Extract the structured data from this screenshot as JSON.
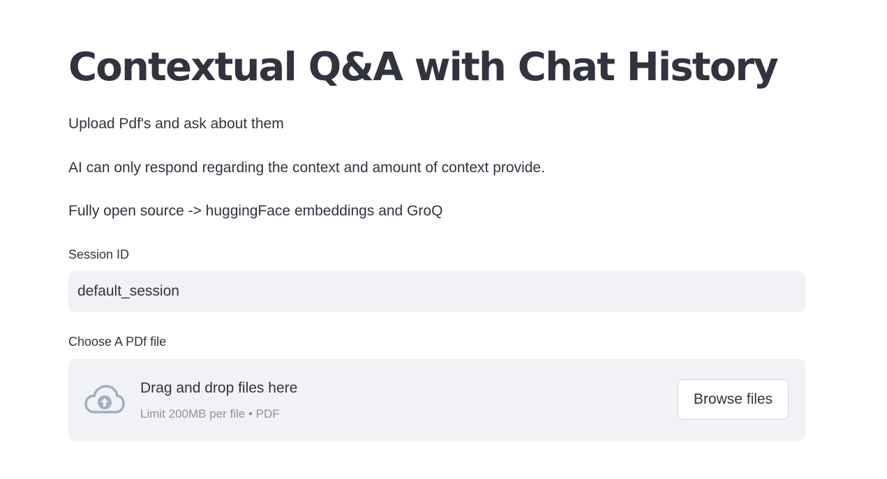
{
  "page": {
    "title": "Contextual Q&A with Chat History",
    "paragraphs": [
      "Upload Pdf's and ask about them",
      "AI can only respond regarding the context and amount of context provide.",
      "Fully open source -> huggingFace embeddings and GroQ"
    ]
  },
  "session": {
    "label": "Session ID",
    "value": "default_session"
  },
  "uploader": {
    "label": "Choose A PDf file",
    "drop_title": "Drag and drop files here",
    "drop_subtitle": "Limit 200MB per file • PDF",
    "browse_label": "Browse files",
    "icon": "cloud-upload-icon"
  },
  "colors": {
    "text": "#31333f",
    "input_bg": "#f0f2f6",
    "muted": "#8f929b",
    "icon": "#a3aec2"
  }
}
